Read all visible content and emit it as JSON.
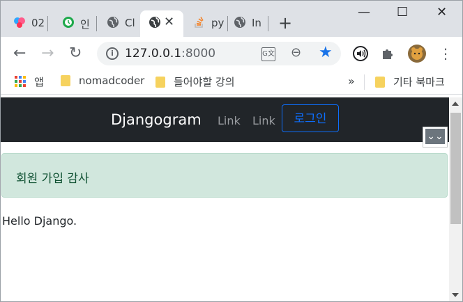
{
  "browser": {
    "tabs": [
      {
        "title": "02",
        "icon": "app-icon"
      },
      {
        "title": "인",
        "icon": "green-clock-icon"
      },
      {
        "title": "Cl",
        "icon": "globe-icon"
      },
      {
        "title": "",
        "icon": "globe-icon",
        "active": true
      },
      {
        "title": "py",
        "icon": "stackoverflow-icon"
      },
      {
        "title": "In",
        "icon": "globe-icon"
      }
    ],
    "new_tab_label": "+",
    "close_label": "✕",
    "window": {
      "minimize": "—",
      "maximize": "☐",
      "close": "✕"
    },
    "address": {
      "host": "127.0.0.1",
      "port": ":8000"
    },
    "bookmarks": {
      "apps_label": "앱",
      "items": [
        "nomadcoder",
        "들어야할 강의"
      ],
      "overflow": "»",
      "other": "기타 북마크"
    }
  },
  "site": {
    "brand": "Djangogram",
    "links": [
      "Link",
      "Link"
    ],
    "login_label": "로그인",
    "alert_text": "회원 가입 감사",
    "body_text": "Hello Django."
  },
  "colors": {
    "navbar_bg": "#212529",
    "login_accent": "#0d6efd",
    "alert_bg": "#d1e7dd",
    "alert_text": "#0f5132",
    "star": "#1a73e8"
  }
}
